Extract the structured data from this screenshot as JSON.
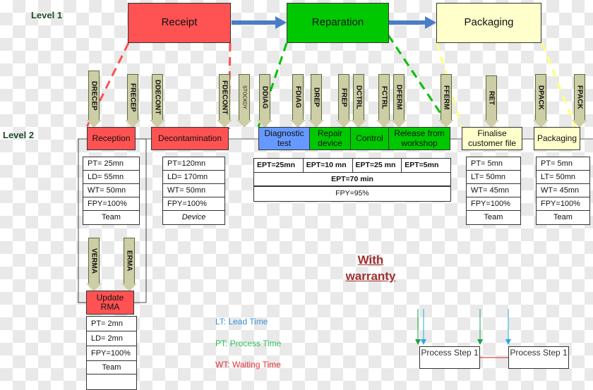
{
  "levels": {
    "level1": "Level 1",
    "level2": "Level 2"
  },
  "level1_processes": [
    {
      "label": "Receipt",
      "color": "#ff5252"
    },
    {
      "label": "Reparation",
      "color": "#00c800"
    },
    {
      "label": "Packaging",
      "color": "#ffffcc"
    }
  ],
  "level2_processes": {
    "reception": "Reception",
    "decontamination": "Decontamination",
    "diagnostic": "Diagnostic test",
    "repair": "Repair device",
    "control": "Control",
    "release": "Release from workshop",
    "finalise": "Finalise customer file",
    "packaging": "Packaging",
    "update_rma": "Update RMA"
  },
  "flow_arrows": [
    "DRECEP",
    "FRECEP",
    "DDECONT",
    "FDECONT",
    "STOCKDY",
    "DDIAG",
    "FDIAG",
    "DREP",
    "FREP",
    "DCTRL",
    "FCTRL",
    "DFERM",
    "FFERM",
    "RET",
    "DPACK",
    "FPACK",
    "VERMA",
    "ERMA"
  ],
  "tables": {
    "reception": [
      "PT= 25mn",
      "LD= 55mn",
      "WT= 50mn",
      "FPY=100%",
      "Team"
    ],
    "decontamination": [
      "PT=120mn",
      "LD= 170mn",
      "WT= 50mn",
      "FPY=100%",
      "Device"
    ],
    "finalise": [
      "PT= 5mn",
      "LT= 50mn",
      "WT= 45mn",
      "FPY=100%",
      "Team"
    ],
    "packaging": [
      "PT= 5mn",
      "LT= 50mn",
      "WT= 45mn",
      "FPY=100%",
      "Team"
    ],
    "update_rma": [
      "PT= 2mn",
      "LD= 2mn",
      "FPY=100%",
      "Team",
      ""
    ]
  },
  "reparation_table": {
    "ept_cells": [
      "EPT=25mn",
      "EPT=10 mn",
      "EPT=25 mn",
      "EPT=5mn"
    ],
    "ept_total": "EPT=70 min",
    "fpy": "FPY=95%"
  },
  "warranty": {
    "line1": "With",
    "line2": "warranty"
  },
  "legend": [
    {
      "text": "LT: Lead Time",
      "color": "#3a8fd6"
    },
    {
      "text": "PT: Process Time",
      "color": "#2cbf5a"
    },
    {
      "text": "WT: Waiting Time",
      "color": "#e8353a"
    }
  ],
  "mini_diagram": {
    "step1": "Process Step 1",
    "step2": "Process Step 1",
    "green_color": "#1aa050",
    "blue_color": "#29a8e0",
    "link_color": "#dd2222"
  }
}
